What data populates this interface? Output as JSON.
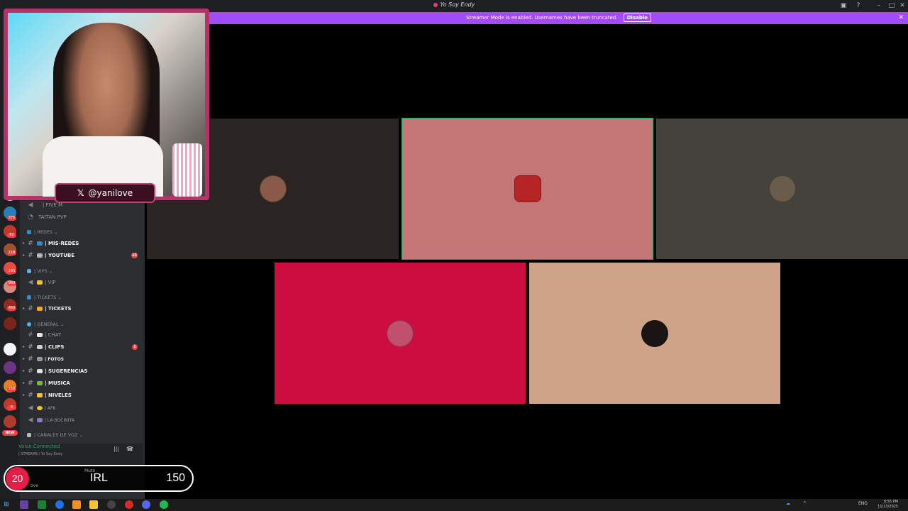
{
  "window": {
    "title": "Yo Soy Endy"
  },
  "banner": {
    "text": "Streamer Mode is enabled. Usernames have been truncated.",
    "disable_label": "Disable",
    "color": "#a14cf6"
  },
  "webcam": {
    "handle": "@yanilove"
  },
  "sidebar": {
    "channels": [
      {
        "label": "| FIVE M",
        "kind": "voice",
        "bold": false
      },
      {
        "label": "TAITAN PVP",
        "kind": "voice",
        "bold": false
      },
      {
        "label": "| REDES",
        "kind": "category"
      },
      {
        "label": "| MIS-REDES",
        "kind": "text",
        "bold": true
      },
      {
        "label": "| YOUTUBE",
        "kind": "text",
        "bold": true,
        "unread": "13"
      },
      {
        "label": "| VIPS",
        "kind": "category"
      },
      {
        "label": "| VIP",
        "kind": "voice",
        "bold": false
      },
      {
        "label": "| TICKETS",
        "kind": "category"
      },
      {
        "label": "| TICKETS",
        "kind": "text",
        "bold": true
      },
      {
        "label": "| GENERAL",
        "kind": "category"
      },
      {
        "label": "| CHAT",
        "kind": "text",
        "bold": false
      },
      {
        "label": "| CLIPS",
        "kind": "text",
        "bold": true,
        "unread": "1"
      },
      {
        "label": "| FOTOS",
        "kind": "text",
        "bold": true
      },
      {
        "label": "| SUGERENCIAS",
        "kind": "text",
        "bold": true
      },
      {
        "label": "| MUSICA",
        "kind": "text",
        "bold": true
      },
      {
        "label": "| NIVELES",
        "kind": "text",
        "bold": true
      },
      {
        "label": "| AFK",
        "kind": "voice",
        "bold": false
      },
      {
        "label": "| LA BOCINITA",
        "kind": "voice",
        "bold": false
      },
      {
        "label": "| CANALES DE VOZ",
        "kind": "category"
      }
    ],
    "voice_connected": "Voice Connected",
    "voice_channel": "| STREAMS / Yo Soy Endy"
  },
  "rail": {
    "badges": [
      "141",
      "375",
      "82",
      "118",
      "193",
      "980",
      "469",
      "159",
      "8",
      "199",
      "4"
    ],
    "new_label": "NEW"
  },
  "irl_widget": {
    "current": "20",
    "label": "IRL",
    "goal": "150",
    "mute_label": "Mute",
    "user_fragment": "ove"
  },
  "tiles": [
    {
      "name": "participant-1",
      "bg": "#2a2422",
      "avatar": "#8a5a48"
    },
    {
      "name": "participant-2",
      "bg": "#c57777",
      "avatar": "#b62525",
      "speaking": true
    },
    {
      "name": "participant-3",
      "bg": "#45413c",
      "avatar": "#6a5c4a"
    },
    {
      "name": "participant-4",
      "bg": "#cd0d3f",
      "avatar": "#c0506e"
    },
    {
      "name": "participant-5",
      "bg": "#cfa388",
      "avatar": "#1a1414"
    }
  ],
  "taskbar": {
    "language": "ENG",
    "time": "8:55 PM",
    "date": "11/13/2025"
  }
}
